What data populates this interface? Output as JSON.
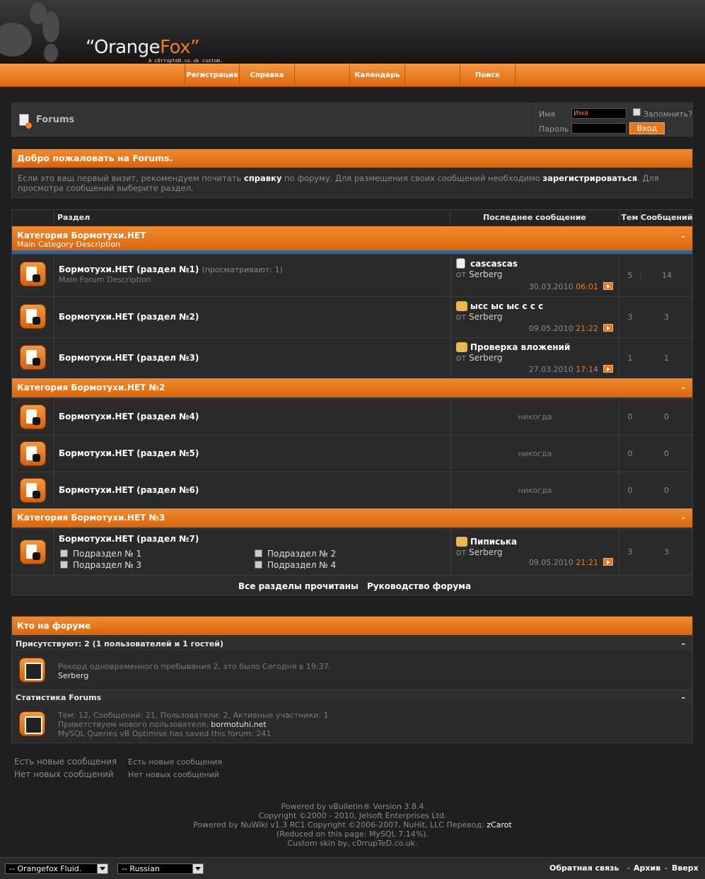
{
  "header": {
    "logo_text_1": "“Orange",
    "logo_text_2": "Fox”",
    "logo_sub": "A c0rrupteD.co.uk custom."
  },
  "nav": [
    {
      "label": "Регистрация"
    },
    {
      "label": "Справка"
    },
    {
      "label": ""
    },
    {
      "label": "Календарь"
    },
    {
      "label": ""
    },
    {
      "label": "Поиск"
    }
  ],
  "topbar": {
    "title": "Forums"
  },
  "login": {
    "username_label": "Имя",
    "username_value": "Имя",
    "password_label": "Пароль",
    "remember_label": "Запомнить?",
    "submit_label": "Вход"
  },
  "welcome": {
    "title": "Добро пожаловать на Forums.",
    "text_1": "Если это ваш первый визит, рекомендуем почитать ",
    "link_1": "справку",
    "text_2": " по форуму. Для размещения своих сообщений необходимо ",
    "link_2": "зарегистрироваться",
    "text_3": ". Для просмотра сообщений выберите раздел."
  },
  "table_headers": {
    "section": "Раздел",
    "last_post": "Последнее сообщение",
    "threads": "Тем",
    "posts": "Сообщений"
  },
  "categories": [
    {
      "title": "Категория Бормотухи.НЕТ",
      "description": "Main Category Description",
      "collapse": "–"
    },
    {
      "title": "Категория Бормотухи.НЕТ №2",
      "collapse": "–"
    },
    {
      "title": "Категория Бормотухи.НЕТ №3",
      "collapse": "–"
    }
  ],
  "forums": [
    {
      "name": "Бормотухи.НЕТ (раздел №1)",
      "viewing": "(просматривают: 1)",
      "description": "Main Forum Description",
      "last_title": "cascascas",
      "last_by_prefix": "от",
      "last_by": "Serberg",
      "last_date": "30.03.2010",
      "last_time": "06:01",
      "threads": "5",
      "posts": "14"
    },
    {
      "name": "Бормотухи.НЕТ (раздел №2)",
      "last_title": "ысс ыс ыс с с с",
      "last_by_prefix": "от",
      "last_by": "Serberg",
      "last_date": "09.05.2010",
      "last_time": "21:22",
      "threads": "3",
      "posts": "3"
    },
    {
      "name": "Бормотухи.НЕТ (раздел №3)",
      "last_title": "Проверка вложений",
      "last_by_prefix": "от",
      "last_by": "Serberg",
      "last_date": "27.03.2010",
      "last_time": "17:14",
      "threads": "1",
      "posts": "1"
    },
    {
      "name": "Бормотухи.НЕТ (раздел №4)",
      "never": "никогда",
      "threads": "0",
      "posts": "0"
    },
    {
      "name": "Бормотухи.НЕТ (раздел №5)",
      "never": "никогда",
      "threads": "0",
      "posts": "0"
    },
    {
      "name": "Бормотухи.НЕТ (раздел №6)",
      "never": "никогда",
      "threads": "0",
      "posts": "0"
    },
    {
      "name": "Бормотухи.НЕТ (раздел №7)",
      "last_title": "Пиписька",
      "last_by_prefix": "от",
      "last_by": "Serberg",
      "last_date": "09.05.2010",
      "last_time": "21:21",
      "threads": "3",
      "posts": "3",
      "subforums": [
        "Подраздел № 1",
        "Подраздел № 2",
        "Подраздел № 3",
        "Подраздел № 4"
      ]
    }
  ],
  "forum_footer": {
    "mark_read": "Все разделы прочитаны",
    "leaders": "Руководство форума"
  },
  "whos_online": {
    "title": "Кто на форуме",
    "present": "Присутствуют: 2 (1 пользователей и 1 гостей)",
    "record": "Рекорд одновременного пребывания 2, это было Сегодня в 19:37.",
    "user": "Serberg",
    "stats_title": "Статистика Forums",
    "stats": "Тем: 12, Сообщений: 21, Пользователи: 2, Активные участники: 1",
    "welcome_prefix": "Приветствуем нового пользователя, ",
    "new_user": "bormotuhi.net",
    "mysql": "MySQL Queries vB Optimise has saved this forum: 241",
    "collapse": "–"
  },
  "legend": {
    "new_1": "Есть новые сообщения",
    "new_2": "Есть новые сообщения",
    "old_1": "Нет новых сообщений",
    "old_2": "Нет новых сообщений"
  },
  "credits": {
    "line1": "Powered by vBulletin® Version 3.8.4",
    "line2": "Copyright ©2000 - 2010, Jelsoft Enterprises Ltd.",
    "line3": "Powered by NuWiki v1.3 RC1 Copyright ©2006-2007, NuHit, LLC Перевод: ",
    "line3_name": "zCarot",
    "line4": "(Reduced on this page: MySQL 7.14%).",
    "line5": "Custom skin by, c0rrupTeD.co.uk."
  },
  "bottom": {
    "style_select": "-- Orangefox Fluid.",
    "lang_select": "-- Russian",
    "contact": "Обратная связь",
    "archive": "Архив",
    "top": "Вверх"
  },
  "colors": {
    "accent": "#f07c1a",
    "background": "#1f1f1f",
    "panel": "#2b2b2b"
  }
}
